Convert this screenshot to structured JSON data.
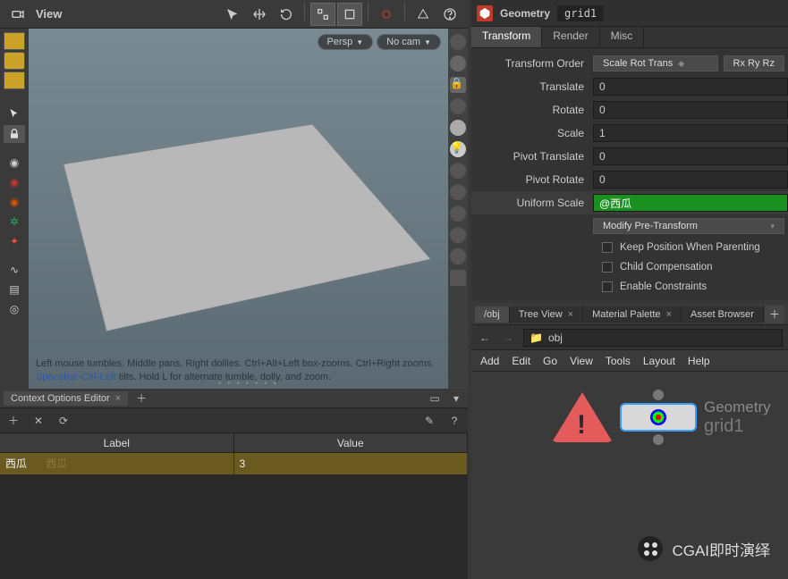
{
  "view": {
    "title": "View",
    "persp": "Persp",
    "nocam": "No cam",
    "hint_line1": "Left mouse tumbles. Middle pans. Right dollies. Ctrl+Alt+Left box-zooms. Ctrl+Right zooms.",
    "hint_link": "Spacebar-Ctrl-Left",
    "hint_line2": " tilts. Hold L for alternate tumble, dolly, and zoom."
  },
  "context_editor": {
    "tab_title": "Context Options Editor",
    "columns": {
      "label": "Label",
      "value": "Value"
    },
    "rows": [
      {
        "label": "西瓜",
        "placeholder": "西瓜",
        "value": "3"
      }
    ]
  },
  "params": {
    "type_label": "Geometry",
    "node_name": "grid1",
    "tabs": [
      "Transform",
      "Render",
      "Misc"
    ],
    "active_tab": "Transform",
    "transform_order_label": "Transform Order",
    "transform_order_value": "Scale Rot Trans",
    "rot_order_value": "Rx Ry Rz",
    "fields": {
      "translate": {
        "label": "Translate",
        "value": "0"
      },
      "rotate": {
        "label": "Rotate",
        "value": "0"
      },
      "scale": {
        "label": "Scale",
        "value": "1"
      },
      "pivot_translate": {
        "label": "Pivot Translate",
        "value": "0"
      },
      "pivot_rotate": {
        "label": "Pivot Rotate",
        "value": "0"
      },
      "uniform_scale": {
        "label": "Uniform Scale",
        "value": "@西瓜"
      }
    },
    "modify_pre_transform": "Modify Pre-Transform",
    "checkboxes": {
      "keep_position": "Keep Position When Parenting",
      "child_comp": "Child Compensation",
      "enable_constraints": "Enable Constraints"
    }
  },
  "network": {
    "tabs": [
      {
        "label": "/obj",
        "active": true
      },
      {
        "label": "Tree View",
        "active": false
      },
      {
        "label": "Material Palette",
        "active": false
      },
      {
        "label": "Asset Browser",
        "active": false
      }
    ],
    "path": "obj",
    "menus": [
      "Add",
      "Edit",
      "Go",
      "View",
      "Tools",
      "Layout",
      "Help"
    ],
    "node": {
      "type": "Geometry",
      "name": "grid1"
    },
    "watermark": "CGAI即时演绎"
  }
}
